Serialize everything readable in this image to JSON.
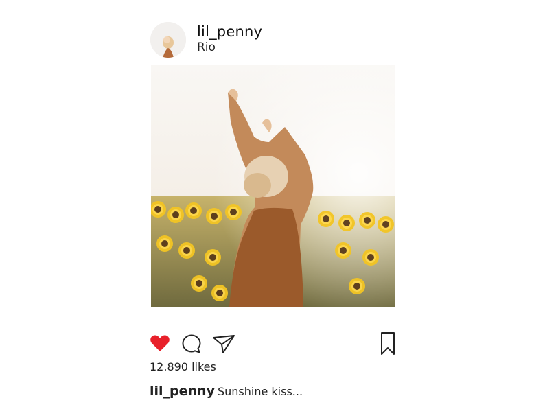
{
  "post": {
    "username": "lil_penny",
    "location": "Rio",
    "likes": "12.890 likes",
    "caption_user": "lil_penny",
    "caption_text": "Sunshine kiss..."
  },
  "icons": {
    "like": "heart-icon",
    "comment": "comment-icon",
    "share": "paper-plane-icon",
    "bookmark": "bookmark-icon"
  },
  "colors": {
    "like_active": "#e8202a",
    "text": "#222222",
    "background": "#ffffff"
  }
}
